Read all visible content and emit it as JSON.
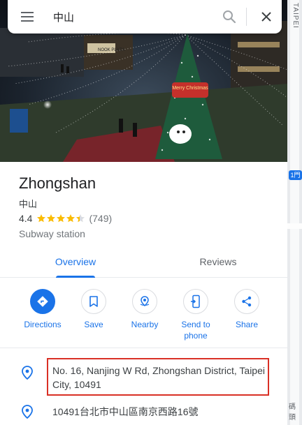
{
  "search": {
    "query": "中山"
  },
  "map": {
    "vertical_label": "TAIPEI",
    "station_badge": "1門",
    "corner_label": "碼頭"
  },
  "place": {
    "name": "Zhongshan",
    "native_name": "中山",
    "rating": "4.4",
    "stars": 4.4,
    "review_count": "(749)",
    "category": "Subway station"
  },
  "tabs": [
    {
      "label": "Overview",
      "active": true
    },
    {
      "label": "Reviews",
      "active": false
    }
  ],
  "actions": [
    {
      "label": "Directions",
      "icon": "directions-icon"
    },
    {
      "label": "Save",
      "icon": "bookmark-icon"
    },
    {
      "label": "Nearby",
      "icon": "nearby-icon"
    },
    {
      "label": "Send to phone",
      "icon": "phone-icon"
    },
    {
      "label": "Share",
      "icon": "share-icon"
    }
  ],
  "details": {
    "address_en": "No. 16, Nanjing W Rd, Zhongshan District, Taipei City, 10491",
    "address_zh": "10491台北市中山區南京西路16號"
  },
  "photo_text": {
    "sign": "Merry Christmas",
    "store": "NOOK PLAZA"
  },
  "colors": {
    "accent": "#1a73e8",
    "highlight": "#d93025",
    "star": "#fbbc04"
  }
}
